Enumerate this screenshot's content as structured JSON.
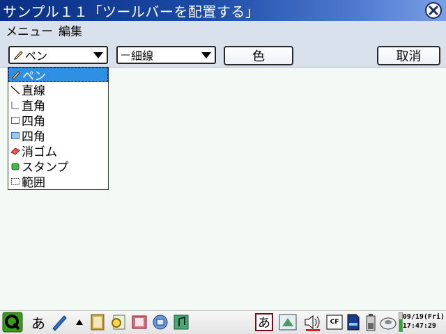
{
  "window": {
    "title": "サンプル１１「ツールバーを配置する」"
  },
  "menubar": {
    "items": [
      {
        "label": "メニュー"
      },
      {
        "label": "編集"
      }
    ]
  },
  "toolbar": {
    "tool_select": {
      "value": "ペン"
    },
    "line_select": {
      "value": "細線"
    },
    "color_button": {
      "label": "色"
    },
    "cancel_button": {
      "label": "取消"
    }
  },
  "tool_list": {
    "items": [
      {
        "label": "ペン",
        "icon": "pencil-icon",
        "selected": true
      },
      {
        "label": "直線",
        "icon": "line-icon"
      },
      {
        "label": "直角",
        "icon": "right-angle-icon"
      },
      {
        "label": "四角",
        "icon": "rectangle-outline-icon"
      },
      {
        "label": "四角",
        "icon": "rectangle-filled-icon"
      },
      {
        "label": "消ゴム",
        "icon": "eraser-icon"
      },
      {
        "label": "スタンプ",
        "icon": "stamp-icon"
      },
      {
        "label": "範囲",
        "icon": "selection-range-icon"
      }
    ]
  },
  "taskbar": {
    "ime_label": "あ",
    "ime_button_label": "あ",
    "cf_label": "CF",
    "clock_date": "09/19(Fri)",
    "clock_time": "17:47:29",
    "colors": {
      "start": "#3a9a1a",
      "accent": "#2f8fe3"
    }
  }
}
